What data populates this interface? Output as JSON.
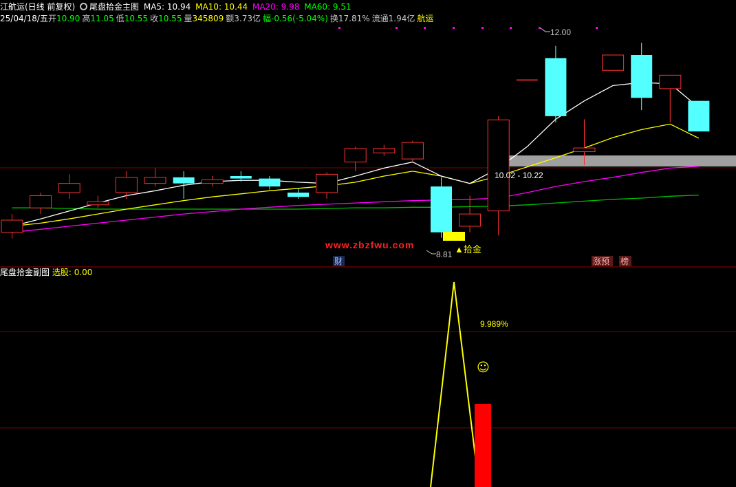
{
  "main_header": {
    "stock_title": "江航运(日线 前复权)",
    "formula_name": "尾盘拾金主图",
    "ma5": {
      "label": "MA5: 10.94",
      "color": "#ffffff"
    },
    "ma10": {
      "label": "MA10: 10.44",
      "color": "#ffff00"
    },
    "ma20": {
      "label": "MA20: 9.98",
      "color": "#ff00ff"
    },
    "ma60": {
      "label": "MA60: 9.51",
      "color": "#00ff00"
    }
  },
  "quote_line": {
    "date": "25/04/18/五",
    "open_label": "开",
    "open_value": "10.90",
    "high_label": "高",
    "high_value": "11.05",
    "low_label": "低",
    "low_value": "10.55",
    "close_label": "收",
    "close_value": "10.55",
    "volume_label": "量",
    "volume_value": "345809",
    "amount": "额3.73亿",
    "change": "幅-0.56(-5.04%)",
    "turnover": "换17.81%",
    "float_cap": "流通1.94亿",
    "sector": "航运"
  },
  "chart_labels": {
    "high_price": "12.00",
    "low_price": "8.81",
    "price_range": "10.02 - 10.22",
    "signal": "▲拾金",
    "watermark": "www.zbzfwu.com",
    "event_cai": "财",
    "event_zhang": "涨预",
    "event_bang": "榜"
  },
  "sub_header": {
    "formula_name": "尾盘拾金副图",
    "select_label": "选股: 0.00"
  },
  "sub_labels": {
    "percent": "9.989%",
    "smiley": "☺"
  },
  "colors": {
    "up": "#ff3232",
    "down": "#54ffff",
    "ma5": "#ffffff",
    "ma10": "#ffff00",
    "ma20": "#ff00ff",
    "ma60": "#00c000",
    "grid": "#800000",
    "band": "#a0a0a0"
  },
  "chart_data": {
    "type": "candlestick",
    "candles": [
      {
        "o": 8.9,
        "c": 9.1,
        "h": 9.2,
        "l": 8.8
      },
      {
        "o": 9.3,
        "c": 9.5,
        "h": 9.55,
        "l": 9.2
      },
      {
        "o": 9.55,
        "c": 9.7,
        "h": 9.85,
        "l": 9.45
      },
      {
        "o": 9.35,
        "c": 9.4,
        "h": 9.5,
        "l": 9.3
      },
      {
        "o": 9.55,
        "c": 9.8,
        "h": 9.9,
        "l": 9.45
      },
      {
        "o": 9.7,
        "c": 9.8,
        "h": 9.95,
        "l": 9.65
      },
      {
        "o": 9.8,
        "c": 9.7,
        "h": 9.9,
        "l": 9.45
      },
      {
        "o": 9.7,
        "c": 9.76,
        "h": 9.82,
        "l": 9.65
      },
      {
        "o": 9.82,
        "c": 9.78,
        "h": 9.9,
        "l": 9.73
      },
      {
        "o": 9.78,
        "c": 9.65,
        "h": 9.82,
        "l": 9.6
      },
      {
        "o": 9.55,
        "c": 9.48,
        "h": 9.62,
        "l": 9.45
      },
      {
        "o": 9.55,
        "c": 9.85,
        "h": 9.88,
        "l": 9.45
      },
      {
        "o": 10.05,
        "c": 10.27,
        "h": 10.3,
        "l": 9.9
      },
      {
        "o": 10.2,
        "c": 10.27,
        "h": 10.33,
        "l": 10.15
      },
      {
        "o": 10.1,
        "c": 10.37,
        "h": 10.4,
        "l": 10.05
      },
      {
        "o": 9.65,
        "c": 8.9,
        "h": 9.8,
        "l": 8.81
      },
      {
        "o": 9.0,
        "c": 9.2,
        "h": 9.5,
        "l": 8.9
      },
      {
        "o": 9.25,
        "c": 10.74,
        "h": 10.8,
        "l": 8.85
      },
      {
        "o": 11.4,
        "c": 11.4,
        "h": 11.4,
        "l": 11.4
      },
      {
        "o": 11.75,
        "c": 10.8,
        "h": 11.95,
        "l": 10.7
      },
      {
        "o": 10.22,
        "c": 10.28,
        "h": 10.75,
        "l": 10.0
      },
      {
        "o": 11.55,
        "c": 11.8,
        "h": 11.8,
        "l": 11.55
      },
      {
        "o": 11.8,
        "c": 11.1,
        "h": 12.0,
        "l": 10.9
      },
      {
        "o": 11.25,
        "c": 11.47,
        "h": 11.47,
        "l": 10.7
      },
      {
        "o": 11.05,
        "c": 10.55,
        "h": 11.05,
        "l": 10.55
      }
    ],
    "ma5": [
      9.0,
      9.12,
      9.25,
      9.38,
      9.5,
      9.58,
      9.67,
      9.73,
      9.75,
      9.75,
      9.72,
      9.7,
      9.82,
      9.95,
      10.05,
      9.82,
      9.7,
      9.95,
      10.3,
      10.75,
      11.05,
      11.3,
      11.35,
      11.33,
      10.94
    ],
    "ma10": [
      9.0,
      9.05,
      9.12,
      9.2,
      9.28,
      9.35,
      9.42,
      9.48,
      9.53,
      9.58,
      9.62,
      9.66,
      9.72,
      9.82,
      9.9,
      9.82,
      9.7,
      9.82,
      9.97,
      10.12,
      10.28,
      10.45,
      10.58,
      10.67,
      10.44
    ],
    "ma20": [
      8.9,
      8.95,
      9.0,
      9.05,
      9.1,
      9.15,
      9.2,
      9.24,
      9.28,
      9.31,
      9.34,
      9.36,
      9.38,
      9.4,
      9.42,
      9.43,
      9.44,
      9.46,
      9.55,
      9.65,
      9.73,
      9.8,
      9.88,
      9.95,
      9.98
    ],
    "ma60": [
      9.3,
      9.3,
      9.29,
      9.28,
      9.28,
      9.28,
      9.28,
      9.28,
      9.28,
      9.28,
      9.28,
      9.29,
      9.3,
      9.3,
      9.31,
      9.31,
      9.32,
      9.33,
      9.35,
      9.38,
      9.41,
      9.44,
      9.46,
      9.49,
      9.51
    ],
    "ylim": [
      8.65,
      12.25
    ]
  }
}
